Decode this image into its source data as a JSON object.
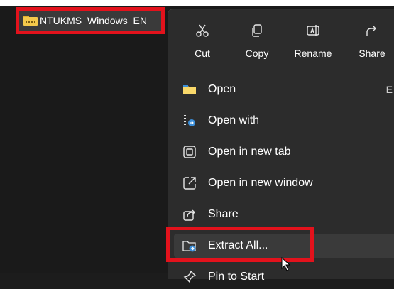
{
  "file": {
    "name": "NTUKMS_Windows_EN",
    "icon": "zip-folder-icon"
  },
  "quick_actions": [
    {
      "label": "Cut",
      "icon": "scissors-icon"
    },
    {
      "label": "Copy",
      "icon": "copy-icon"
    },
    {
      "label": "Rename",
      "icon": "rename-icon"
    },
    {
      "label": "Share",
      "icon": "share-icon"
    }
  ],
  "menu_items": [
    {
      "label": "Open",
      "icon": "folder-icon",
      "shortcut": "E"
    },
    {
      "label": "Open with",
      "icon": "open-with-icon"
    },
    {
      "label": "Open in new tab",
      "icon": "new-tab-icon"
    },
    {
      "label": "Open in new window",
      "icon": "new-window-icon"
    },
    {
      "label": "Share",
      "icon": "share-icon"
    },
    {
      "label": "Extract All...",
      "icon": "extract-icon"
    },
    {
      "label": "Pin to Start",
      "icon": "pin-icon"
    }
  ],
  "colors": {
    "highlight": "#e3121c",
    "menu_bg": "#2c2c2c",
    "folder": "#f4c94b"
  }
}
